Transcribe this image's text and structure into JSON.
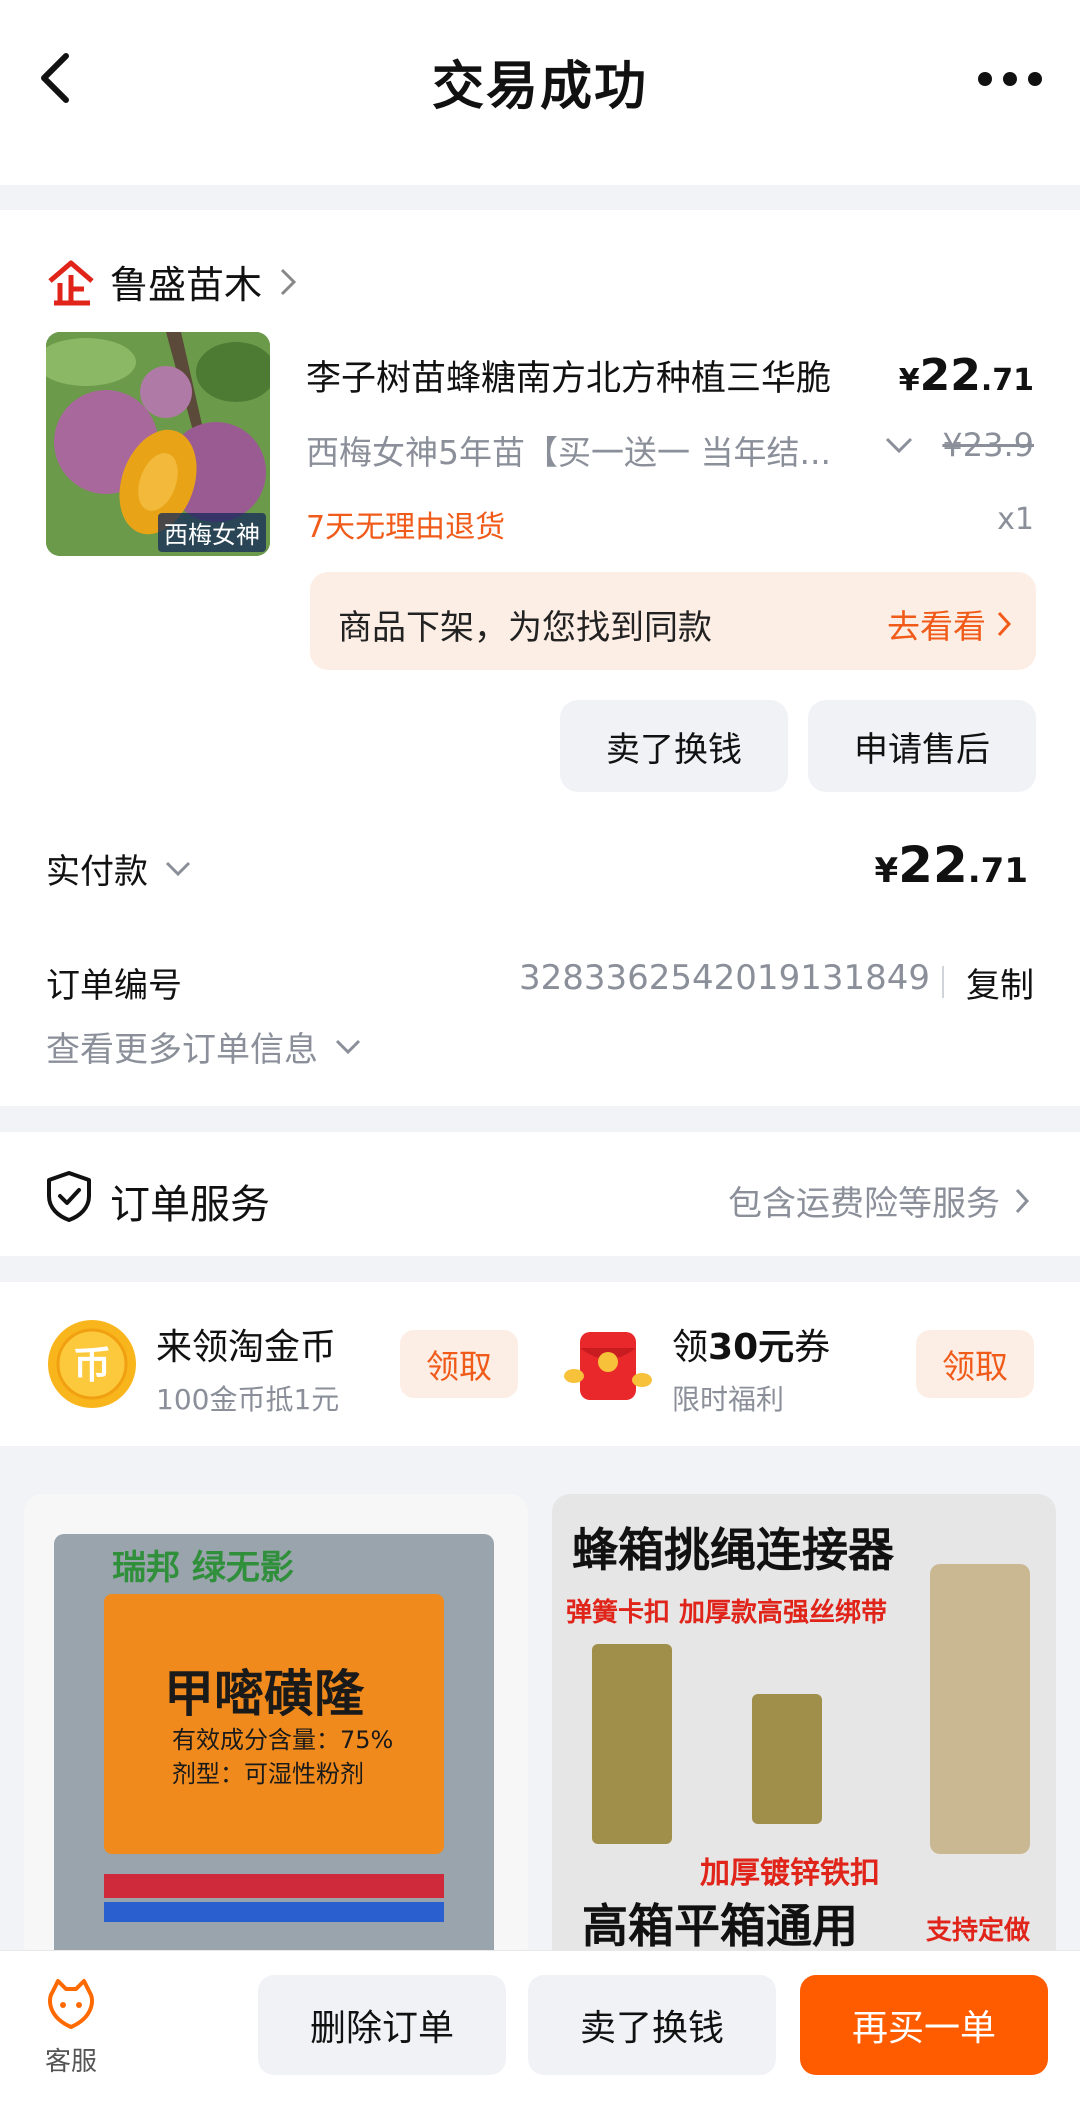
{
  "header": {
    "title": "交易成功"
  },
  "shop": {
    "name": "鲁盛苗木"
  },
  "product": {
    "image_tag": "西梅女神",
    "title": "李子树苗蜂糖南方北方种植三华脆",
    "price_symbol": "¥",
    "price_int": "22",
    "price_dec": ".71",
    "spec": "西梅女神5年苗【买一送一 当年结...",
    "original_price": "¥23.9",
    "return_policy": "7天无理由退货",
    "quantity": "x1"
  },
  "similar": {
    "text": "商品下架，为您找到同款",
    "link": "去看看"
  },
  "actions": {
    "sell": "卖了换钱",
    "after_sale": "申请售后"
  },
  "payment": {
    "label": "实付款",
    "symbol": "¥",
    "int": "22",
    "dec": ".71"
  },
  "order": {
    "number_label": "订单编号",
    "number": "3283362542019131849",
    "copy": "复制",
    "more_info": "查看更多订单信息"
  },
  "service": {
    "label": "订单服务",
    "detail": "包含运费险等服务"
  },
  "rewards": {
    "coin_title": "来领淘金币",
    "coin_sub": "100金币抵1元",
    "claim": "领取",
    "coupon_pre": "领",
    "coupon_amount": "30元",
    "coupon_post": "券",
    "coupon_sub": "限时福利",
    "coin_glyph": "币"
  },
  "feed": [
    {
      "brand": "瑞邦 绿无影",
      "name": "甲嘧磺隆",
      "line1": "有效成分含量：75%",
      "line2": "剂型：可湿性粉剂"
    },
    {
      "title": "蜂箱挑绳连接器",
      "tag1": "弹簧卡扣  加厚款高强丝绑带",
      "tag2": "加厚镀锌铁扣",
      "big": "高箱平箱通用",
      "tag3": "支持定做"
    }
  ],
  "bottom": {
    "service": "客服",
    "delete": "删除订单",
    "sell": "卖了换钱",
    "rebuy": "再买一单"
  },
  "colors": {
    "accent": "#ff5c00",
    "accent_text": "#f05b1a",
    "muted": "#8a8f99"
  }
}
